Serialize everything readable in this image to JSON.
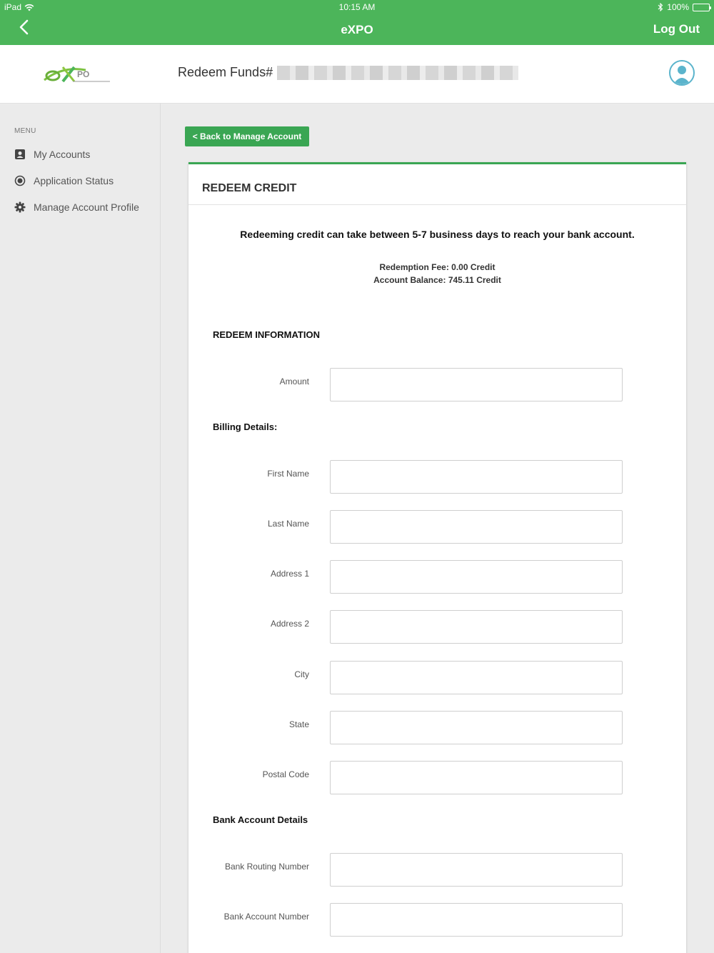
{
  "status_bar": {
    "device": "iPad",
    "time": "10:15 AM",
    "battery": "100%"
  },
  "nav_bar": {
    "title": "eXPO",
    "logout_label": "Log Out",
    "color": "#4cb55a"
  },
  "header": {
    "page_heading": "Redeem Funds#"
  },
  "sidebar": {
    "menu_label": "MENU",
    "items": [
      {
        "label": "My Accounts",
        "icon": "account-box-icon"
      },
      {
        "label": "Application Status",
        "icon": "radio-circle-icon"
      },
      {
        "label": "Manage Account Profile",
        "icon": "gear-icon"
      }
    ]
  },
  "main": {
    "back_button_label": "< Back to Manage Account",
    "card_title": "REDEEM CREDIT",
    "notice": "Redeeming credit can take between 5-7 business days to reach your bank account.",
    "redemption_fee": "Redemption Fee: 0.00 Credit",
    "account_balance": "Account Balance: 745.11 Credit",
    "accent_color": "#3aa653",
    "sections": {
      "redeem_info": "REDEEM INFORMATION",
      "billing": "Billing Details:",
      "bank": "Bank Account Details"
    },
    "fields": {
      "amount": {
        "label": "Amount",
        "value": ""
      },
      "first_name": {
        "label": "First Name",
        "value": ""
      },
      "last_name": {
        "label": "Last Name",
        "value": ""
      },
      "address1": {
        "label": "Address 1",
        "value": ""
      },
      "address2": {
        "label": "Address 2",
        "value": ""
      },
      "city": {
        "label": "City",
        "value": ""
      },
      "state": {
        "label": "State",
        "value": ""
      },
      "postal_code": {
        "label": "Postal Code",
        "value": ""
      },
      "routing_number": {
        "label": "Bank Routing Number",
        "value": ""
      },
      "account_number": {
        "label": "Bank Account Number",
        "value": ""
      }
    }
  }
}
